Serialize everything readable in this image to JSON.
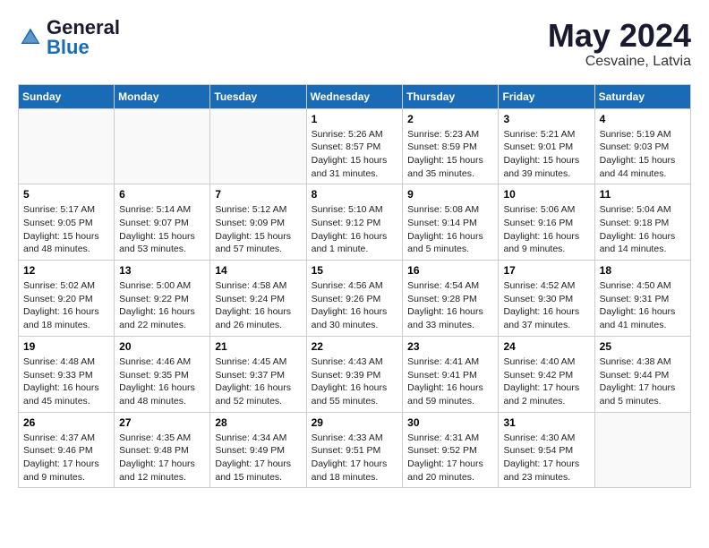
{
  "header": {
    "logo_general": "General",
    "logo_blue": "Blue",
    "month_title": "May 2024",
    "location": "Cesvaine, Latvia"
  },
  "calendar": {
    "days_of_week": [
      "Sunday",
      "Monday",
      "Tuesday",
      "Wednesday",
      "Thursday",
      "Friday",
      "Saturday"
    ],
    "weeks": [
      [
        {
          "day": "",
          "info": ""
        },
        {
          "day": "",
          "info": ""
        },
        {
          "day": "",
          "info": ""
        },
        {
          "day": "1",
          "info": "Sunrise: 5:26 AM\nSunset: 8:57 PM\nDaylight: 15 hours\nand 31 minutes."
        },
        {
          "day": "2",
          "info": "Sunrise: 5:23 AM\nSunset: 8:59 PM\nDaylight: 15 hours\nand 35 minutes."
        },
        {
          "day": "3",
          "info": "Sunrise: 5:21 AM\nSunset: 9:01 PM\nDaylight: 15 hours\nand 39 minutes."
        },
        {
          "day": "4",
          "info": "Sunrise: 5:19 AM\nSunset: 9:03 PM\nDaylight: 15 hours\nand 44 minutes."
        }
      ],
      [
        {
          "day": "5",
          "info": "Sunrise: 5:17 AM\nSunset: 9:05 PM\nDaylight: 15 hours\nand 48 minutes."
        },
        {
          "day": "6",
          "info": "Sunrise: 5:14 AM\nSunset: 9:07 PM\nDaylight: 15 hours\nand 53 minutes."
        },
        {
          "day": "7",
          "info": "Sunrise: 5:12 AM\nSunset: 9:09 PM\nDaylight: 15 hours\nand 57 minutes."
        },
        {
          "day": "8",
          "info": "Sunrise: 5:10 AM\nSunset: 9:12 PM\nDaylight: 16 hours\nand 1 minute."
        },
        {
          "day": "9",
          "info": "Sunrise: 5:08 AM\nSunset: 9:14 PM\nDaylight: 16 hours\nand 5 minutes."
        },
        {
          "day": "10",
          "info": "Sunrise: 5:06 AM\nSunset: 9:16 PM\nDaylight: 16 hours\nand 9 minutes."
        },
        {
          "day": "11",
          "info": "Sunrise: 5:04 AM\nSunset: 9:18 PM\nDaylight: 16 hours\nand 14 minutes."
        }
      ],
      [
        {
          "day": "12",
          "info": "Sunrise: 5:02 AM\nSunset: 9:20 PM\nDaylight: 16 hours\nand 18 minutes."
        },
        {
          "day": "13",
          "info": "Sunrise: 5:00 AM\nSunset: 9:22 PM\nDaylight: 16 hours\nand 22 minutes."
        },
        {
          "day": "14",
          "info": "Sunrise: 4:58 AM\nSunset: 9:24 PM\nDaylight: 16 hours\nand 26 minutes."
        },
        {
          "day": "15",
          "info": "Sunrise: 4:56 AM\nSunset: 9:26 PM\nDaylight: 16 hours\nand 30 minutes."
        },
        {
          "day": "16",
          "info": "Sunrise: 4:54 AM\nSunset: 9:28 PM\nDaylight: 16 hours\nand 33 minutes."
        },
        {
          "day": "17",
          "info": "Sunrise: 4:52 AM\nSunset: 9:30 PM\nDaylight: 16 hours\nand 37 minutes."
        },
        {
          "day": "18",
          "info": "Sunrise: 4:50 AM\nSunset: 9:31 PM\nDaylight: 16 hours\nand 41 minutes."
        }
      ],
      [
        {
          "day": "19",
          "info": "Sunrise: 4:48 AM\nSunset: 9:33 PM\nDaylight: 16 hours\nand 45 minutes."
        },
        {
          "day": "20",
          "info": "Sunrise: 4:46 AM\nSunset: 9:35 PM\nDaylight: 16 hours\nand 48 minutes."
        },
        {
          "day": "21",
          "info": "Sunrise: 4:45 AM\nSunset: 9:37 PM\nDaylight: 16 hours\nand 52 minutes."
        },
        {
          "day": "22",
          "info": "Sunrise: 4:43 AM\nSunset: 9:39 PM\nDaylight: 16 hours\nand 55 minutes."
        },
        {
          "day": "23",
          "info": "Sunrise: 4:41 AM\nSunset: 9:41 PM\nDaylight: 16 hours\nand 59 minutes."
        },
        {
          "day": "24",
          "info": "Sunrise: 4:40 AM\nSunset: 9:42 PM\nDaylight: 17 hours\nand 2 minutes."
        },
        {
          "day": "25",
          "info": "Sunrise: 4:38 AM\nSunset: 9:44 PM\nDaylight: 17 hours\nand 5 minutes."
        }
      ],
      [
        {
          "day": "26",
          "info": "Sunrise: 4:37 AM\nSunset: 9:46 PM\nDaylight: 17 hours\nand 9 minutes."
        },
        {
          "day": "27",
          "info": "Sunrise: 4:35 AM\nSunset: 9:48 PM\nDaylight: 17 hours\nand 12 minutes."
        },
        {
          "day": "28",
          "info": "Sunrise: 4:34 AM\nSunset: 9:49 PM\nDaylight: 17 hours\nand 15 minutes."
        },
        {
          "day": "29",
          "info": "Sunrise: 4:33 AM\nSunset: 9:51 PM\nDaylight: 17 hours\nand 18 minutes."
        },
        {
          "day": "30",
          "info": "Sunrise: 4:31 AM\nSunset: 9:52 PM\nDaylight: 17 hours\nand 20 minutes."
        },
        {
          "day": "31",
          "info": "Sunrise: 4:30 AM\nSunset: 9:54 PM\nDaylight: 17 hours\nand 23 minutes."
        },
        {
          "day": "",
          "info": ""
        }
      ]
    ]
  }
}
